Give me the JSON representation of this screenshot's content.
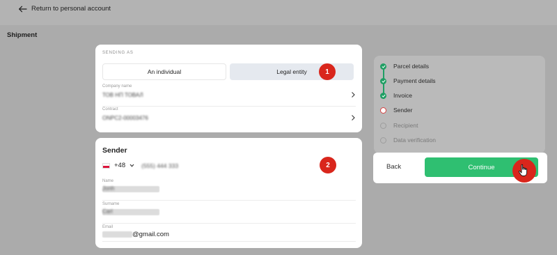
{
  "header": {
    "back_link_label": "Return to personal account"
  },
  "page": {
    "section_title": "Shipment"
  },
  "sending_as": {
    "heading": "SENDING AS",
    "options": [
      "An individual",
      "Legal entity"
    ],
    "selected": "Legal entity"
  },
  "company": {
    "label": "Company name",
    "value": "ТОВ НП ТОВАЛ"
  },
  "contract": {
    "label": "Contract",
    "value": "ONPC2-00003476"
  },
  "sender": {
    "title": "Sender",
    "phone_code": "+48",
    "phone_number": "(555) 444 333",
    "name_label": "Name",
    "name_value": "Jonh",
    "surname_label": "Surname",
    "surname_value": "Carl",
    "email_label": "Email",
    "email_suffix": "@gmail.com"
  },
  "annotations": {
    "step1": "1",
    "step2": "2"
  },
  "steps": [
    {
      "label": "Parcel details",
      "status": "done"
    },
    {
      "label": "Payment details",
      "status": "done"
    },
    {
      "label": "Invoice",
      "status": "done"
    },
    {
      "label": "Sender",
      "status": "current"
    },
    {
      "label": "Recipient",
      "status": "pending"
    },
    {
      "label": "Data verification",
      "status": "pending"
    }
  ],
  "actions": {
    "back_label": "Back",
    "continue_label": "Continue"
  },
  "colors": {
    "accent_green": "#2fbf71",
    "step_done": "#1f9e63",
    "badge_red": "#d9261c"
  },
  "icons": {
    "back": "arrow-left-icon",
    "chevron": "chevron-right-icon",
    "cursor": "hand-pointer-icon"
  }
}
